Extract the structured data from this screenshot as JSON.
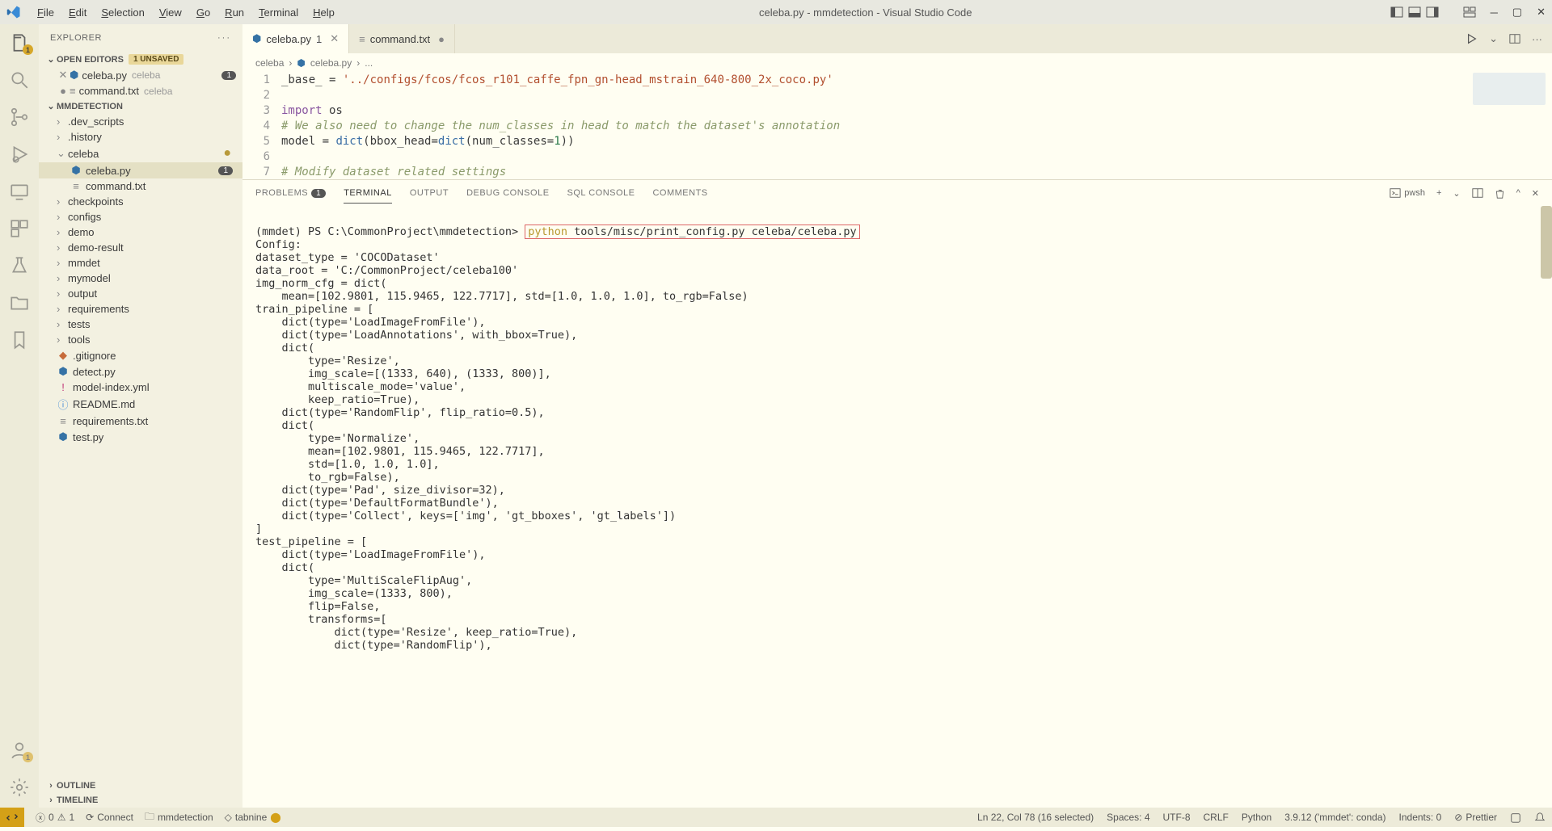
{
  "window": {
    "title": "celeba.py - mmdetection - Visual Studio Code"
  },
  "menu": [
    "File",
    "Edit",
    "Selection",
    "View",
    "Go",
    "Run",
    "Terminal",
    "Help"
  ],
  "explorer": {
    "title": "EXPLORER",
    "openEditors": {
      "label": "OPEN EDITORS",
      "unsaved": "1 UNSAVED",
      "items": [
        {
          "name": "celeba.py",
          "path": "celeba",
          "modified": true,
          "badge": "1",
          "icon": "python"
        },
        {
          "name": "command.txt",
          "path": "celeba",
          "modified": true,
          "dot": true,
          "icon": "text"
        }
      ]
    },
    "workspace": {
      "label": "MMDETECTION",
      "tree": [
        {
          "name": ".dev_scripts",
          "kind": "folder",
          "depth": 1
        },
        {
          "name": ".history",
          "kind": "folder",
          "depth": 1
        },
        {
          "name": "celeba",
          "kind": "folder",
          "depth": 1,
          "expanded": true,
          "modifiedDot": true
        },
        {
          "name": "celeba.py",
          "kind": "file",
          "icon": "python",
          "depth": 2,
          "selected": true,
          "badge": "1"
        },
        {
          "name": "command.txt",
          "kind": "file",
          "icon": "text",
          "depth": 2
        },
        {
          "name": "checkpoints",
          "kind": "folder",
          "depth": 1
        },
        {
          "name": "configs",
          "kind": "folder",
          "depth": 1
        },
        {
          "name": "demo",
          "kind": "folder",
          "depth": 1
        },
        {
          "name": "demo-result",
          "kind": "folder",
          "depth": 1
        },
        {
          "name": "mmdet",
          "kind": "folder",
          "depth": 1
        },
        {
          "name": "mymodel",
          "kind": "folder",
          "depth": 1
        },
        {
          "name": "output",
          "kind": "folder",
          "depth": 1
        },
        {
          "name": "requirements",
          "kind": "folder",
          "depth": 1
        },
        {
          "name": "tests",
          "kind": "folder",
          "depth": 1
        },
        {
          "name": "tools",
          "kind": "folder",
          "depth": 1
        },
        {
          "name": ".gitignore",
          "kind": "file",
          "icon": "git",
          "depth": 1
        },
        {
          "name": "detect.py",
          "kind": "file",
          "icon": "python",
          "depth": 1
        },
        {
          "name": "model-index.yml",
          "kind": "file",
          "icon": "yml",
          "depth": 1
        },
        {
          "name": "README.md",
          "kind": "file",
          "icon": "md",
          "depth": 1
        },
        {
          "name": "requirements.txt",
          "kind": "file",
          "icon": "text",
          "depth": 1
        },
        {
          "name": "test.py",
          "kind": "file",
          "icon": "python",
          "depth": 1
        }
      ]
    },
    "outline": "OUTLINE",
    "timeline": "TIMELINE"
  },
  "tabs": [
    {
      "name": "celeba.py",
      "icon": "python",
      "badge": "1",
      "active": true,
      "close": true
    },
    {
      "name": "command.txt",
      "icon": "text",
      "dot": true
    }
  ],
  "breadcrumb": [
    "celeba",
    "celeba.py",
    "..."
  ],
  "code": {
    "lines": [
      {
        "n": 1,
        "tokens": [
          [
            "var",
            "_base_"
          ],
          [
            "op",
            " = "
          ],
          [
            "str",
            "'../configs/fcos/fcos_r101_caffe_fpn_gn-head_mstrain_640-800_2x_coco.py'"
          ]
        ]
      },
      {
        "n": 2,
        "tokens": []
      },
      {
        "n": 3,
        "tokens": [
          [
            "kw",
            "import"
          ],
          [
            "var",
            " os"
          ]
        ]
      },
      {
        "n": 4,
        "tokens": [
          [
            "cm",
            "# We also need to change the num_classes in head to match the dataset's annotation"
          ]
        ]
      },
      {
        "n": 5,
        "tokens": [
          [
            "var",
            "model "
          ],
          [
            "op",
            "= "
          ],
          [
            "fn",
            "dict"
          ],
          [
            "op",
            "("
          ],
          [
            "var",
            "bbox_head"
          ],
          [
            "op",
            "="
          ],
          [
            "fn",
            "dict"
          ],
          [
            "op",
            "("
          ],
          [
            "var",
            "num_classes"
          ],
          [
            "op",
            "="
          ],
          [
            "num",
            "1"
          ],
          [
            "op",
            "))"
          ]
        ]
      },
      {
        "n": 6,
        "tokens": []
      },
      {
        "n": 7,
        "tokens": [
          [
            "cm",
            "# Modify dataset related settings"
          ]
        ]
      }
    ]
  },
  "panelTabs": {
    "problems": "PROBLEMS",
    "problemsBadge": "1",
    "terminal": "TERMINAL",
    "output": "OUTPUT",
    "debug": "DEBUG CONSOLE",
    "sql": "SQL CONSOLE",
    "comments": "COMMENTS",
    "shell": "pwsh"
  },
  "terminal": {
    "prompt": "(mmdet) PS C:\\CommonProject\\mmdetection>",
    "command_py": "python",
    "command_rest": " tools/misc/print_config.py celeba/celeba.py",
    "output": "Config:\ndataset_type = 'COCODataset'\ndata_root = 'C:/CommonProject/celeba100'\nimg_norm_cfg = dict(\n    mean=[102.9801, 115.9465, 122.7717], std=[1.0, 1.0, 1.0], to_rgb=False)\ntrain_pipeline = [\n    dict(type='LoadImageFromFile'),\n    dict(type='LoadAnnotations', with_bbox=True),\n    dict(\n        type='Resize',\n        img_scale=[(1333, 640), (1333, 800)],\n        multiscale_mode='value',\n        keep_ratio=True),\n    dict(type='RandomFlip', flip_ratio=0.5),\n    dict(\n        type='Normalize',\n        mean=[102.9801, 115.9465, 122.7717],\n        std=[1.0, 1.0, 1.0],\n        to_rgb=False),\n    dict(type='Pad', size_divisor=32),\n    dict(type='DefaultFormatBundle'),\n    dict(type='Collect', keys=['img', 'gt_bboxes', 'gt_labels'])\n]\ntest_pipeline = [\n    dict(type='LoadImageFromFile'),\n    dict(\n        type='MultiScaleFlipAug',\n        img_scale=(1333, 800),\n        flip=False,\n        transforms=[\n            dict(type='Resize', keep_ratio=True),\n            dict(type='RandomFlip'),"
  },
  "statusbar": {
    "errors": "0",
    "warnings": "1",
    "connect": "Connect",
    "workspace": "mmdetection",
    "tabnine": "tabnine",
    "lncol": "Ln 22, Col 78 (16 selected)",
    "spaces": "Spaces: 4",
    "encoding": "UTF-8",
    "eol": "CRLF",
    "lang": "Python",
    "interp": "3.9.12 ('mmdet': conda)",
    "indents": "Indents: 0",
    "prettier": "Prettier"
  }
}
